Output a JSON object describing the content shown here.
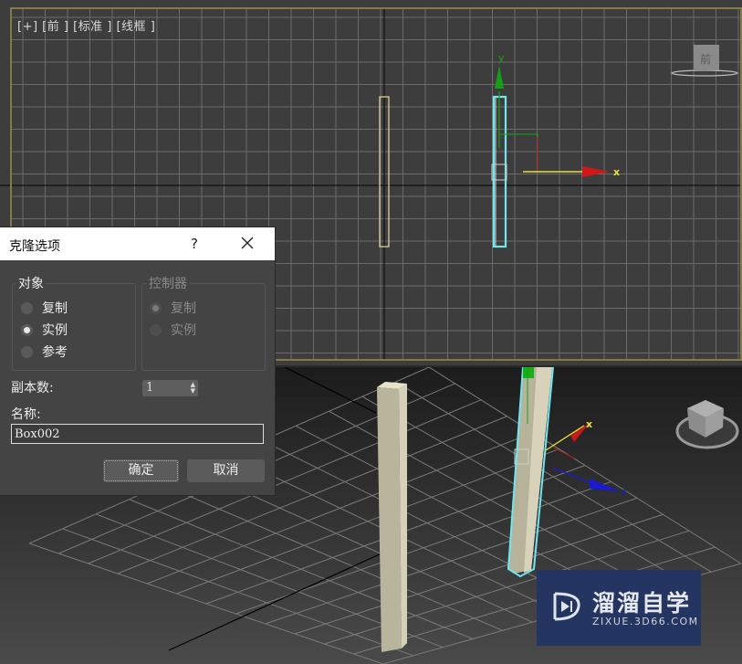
{
  "viewport_top": {
    "label": "[+] [前 ] [标准 ] [线框 ]",
    "border_color": "#7a7040",
    "axis_labels": {
      "x": "x",
      "y": "y"
    },
    "viewcube_label": "前"
  },
  "viewport_perspective": {
    "axis_labels": {
      "x": "x",
      "z": "z"
    }
  },
  "dialog": {
    "title": "克隆选项",
    "help_label": "?",
    "object_group": {
      "title": "对象",
      "options": [
        {
          "label": "复制",
          "selected": false
        },
        {
          "label": "实例",
          "selected": true
        },
        {
          "label": "参考",
          "selected": false
        }
      ]
    },
    "controller_group": {
      "title": "控制器",
      "disabled": true,
      "options": [
        {
          "label": "复制",
          "selected": true
        },
        {
          "label": "实例",
          "selected": false
        }
      ]
    },
    "copies_label": "副本数:",
    "copies_value": "1",
    "name_label": "名称:",
    "name_value": "Box002",
    "ok_label": "确定",
    "cancel_label": "取消"
  },
  "watermark": {
    "title": "溜溜自学",
    "url": "ZIXUE.3D66.COM"
  }
}
